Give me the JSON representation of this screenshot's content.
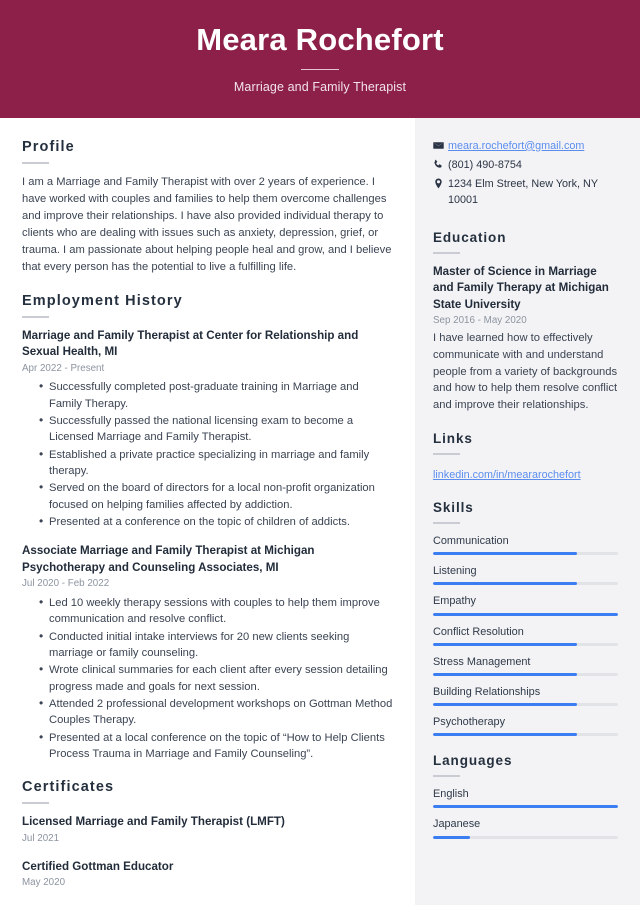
{
  "header": {
    "name": "Meara Rochefort",
    "job_title": "Marriage and Family Therapist"
  },
  "theme": {
    "header_bg": "#8d2049",
    "sidebar_bg": "#f3f3f5",
    "accent_bar": "#3b7ef2",
    "link_color": "#5b8def",
    "text_color": "#2b3445"
  },
  "main": {
    "profile": {
      "heading": "Profile",
      "text": "I am a Marriage and Family Therapist with over 2 years of experience. I have worked with couples and families to help them overcome challenges and improve their relationships. I have also provided individual therapy to clients who are dealing with issues such as anxiety, depression, grief, or trauma. I am passionate about helping people heal and grow, and I believe that every person has the potential to live a fulfilling life."
    },
    "employment": {
      "heading": "Employment History",
      "jobs": [
        {
          "title": "Marriage and Family Therapist at Center for Relationship and Sexual Health, MI",
          "date": "Apr 2022 - Present",
          "bullets": [
            "Successfully completed post-graduate training in Marriage and Family Therapy.",
            "Successfully passed the national licensing exam to become a Licensed Marriage and Family Therapist.",
            "Established a private practice specializing in marriage and family therapy.",
            "Served on the board of directors for a local non-profit organization focused on helping families affected by addiction.",
            "Presented at a conference on the topic of children of addicts."
          ]
        },
        {
          "title": "Associate Marriage and Family Therapist at Michigan Psychotherapy and Counseling Associates, MI",
          "date": "Jul 2020 - Feb 2022",
          "bullets": [
            "Led 10 weekly therapy sessions with couples to help them improve communication and resolve conflict.",
            "Conducted initial intake interviews for 20 new clients seeking marriage or family counseling.",
            "Wrote clinical summaries for each client after every session detailing progress made and goals for next session.",
            "Attended 2 professional development workshops on Gottman Method Couples Therapy.",
            "Presented at a local conference on the topic of “How to Help Clients Process Trauma in Marriage and Family Counseling”."
          ]
        }
      ]
    },
    "certificates": {
      "heading": "Certificates",
      "items": [
        {
          "title": "Licensed Marriage and Family Therapist (LMFT)",
          "date": "Jul 2021"
        },
        {
          "title": "Certified Gottman Educator",
          "date": "May 2020"
        }
      ]
    }
  },
  "sidebar": {
    "contact": {
      "email": "meara.rochefort@gmail.com",
      "phone": "(801) 490-8754",
      "address": "1234 Elm Street, New York, NY 10001"
    },
    "education": {
      "heading": "Education",
      "items": [
        {
          "title": "Master of Science in Marriage and Family Therapy at Michigan State University",
          "date": "Sep 2016 - May 2020",
          "description": "I have learned how to effectively communicate with and understand people from a variety of backgrounds and how to help them resolve conflict and improve their relationships."
        }
      ]
    },
    "links": {
      "heading": "Links",
      "items": [
        {
          "label": "linkedin.com/in/meararochefort"
        }
      ]
    },
    "skills": {
      "heading": "Skills",
      "items": [
        {
          "label": "Communication",
          "level": 78
        },
        {
          "label": "Listening",
          "level": 78
        },
        {
          "label": "Empathy",
          "level": 100
        },
        {
          "label": "Conflict Resolution",
          "level": 78
        },
        {
          "label": "Stress Management",
          "level": 78
        },
        {
          "label": "Building Relationships",
          "level": 78
        },
        {
          "label": "Psychotherapy",
          "level": 78
        }
      ]
    },
    "languages": {
      "heading": "Languages",
      "items": [
        {
          "label": "English",
          "level": 100
        },
        {
          "label": "Japanese",
          "level": 20
        }
      ]
    }
  }
}
